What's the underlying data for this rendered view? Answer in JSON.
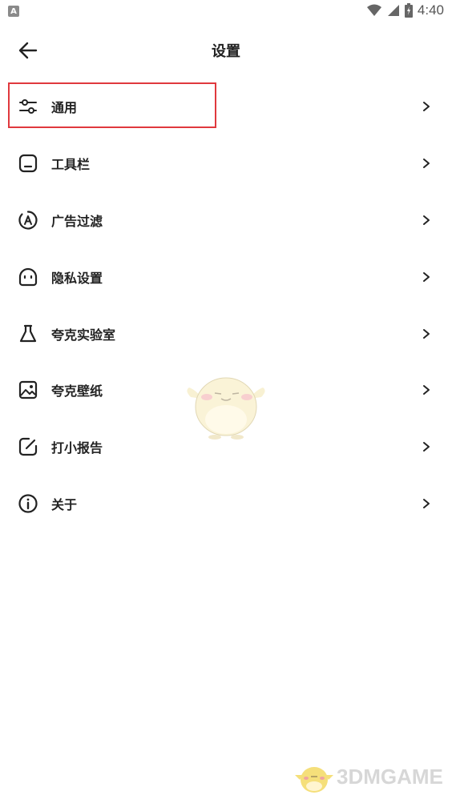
{
  "status_bar": {
    "time": "4:40"
  },
  "header": {
    "title": "设置"
  },
  "menu": {
    "items": [
      {
        "label": "通用",
        "icon": "sliders-icon"
      },
      {
        "label": "工具栏",
        "icon": "toolbar-icon"
      },
      {
        "label": "广告过滤",
        "icon": "ad-filter-icon"
      },
      {
        "label": "隐私设置",
        "icon": "privacy-mask-icon"
      },
      {
        "label": "夸克实验室",
        "icon": "flask-icon"
      },
      {
        "label": "夸克壁纸",
        "icon": "image-icon"
      },
      {
        "label": "打小报告",
        "icon": "edit-report-icon"
      },
      {
        "label": "关于",
        "icon": "info-icon"
      }
    ]
  },
  "colors": {
    "highlight": "#e0393e",
    "text": "#222222",
    "icon": "#222222"
  },
  "watermark": {
    "text": "3DMGAME"
  }
}
